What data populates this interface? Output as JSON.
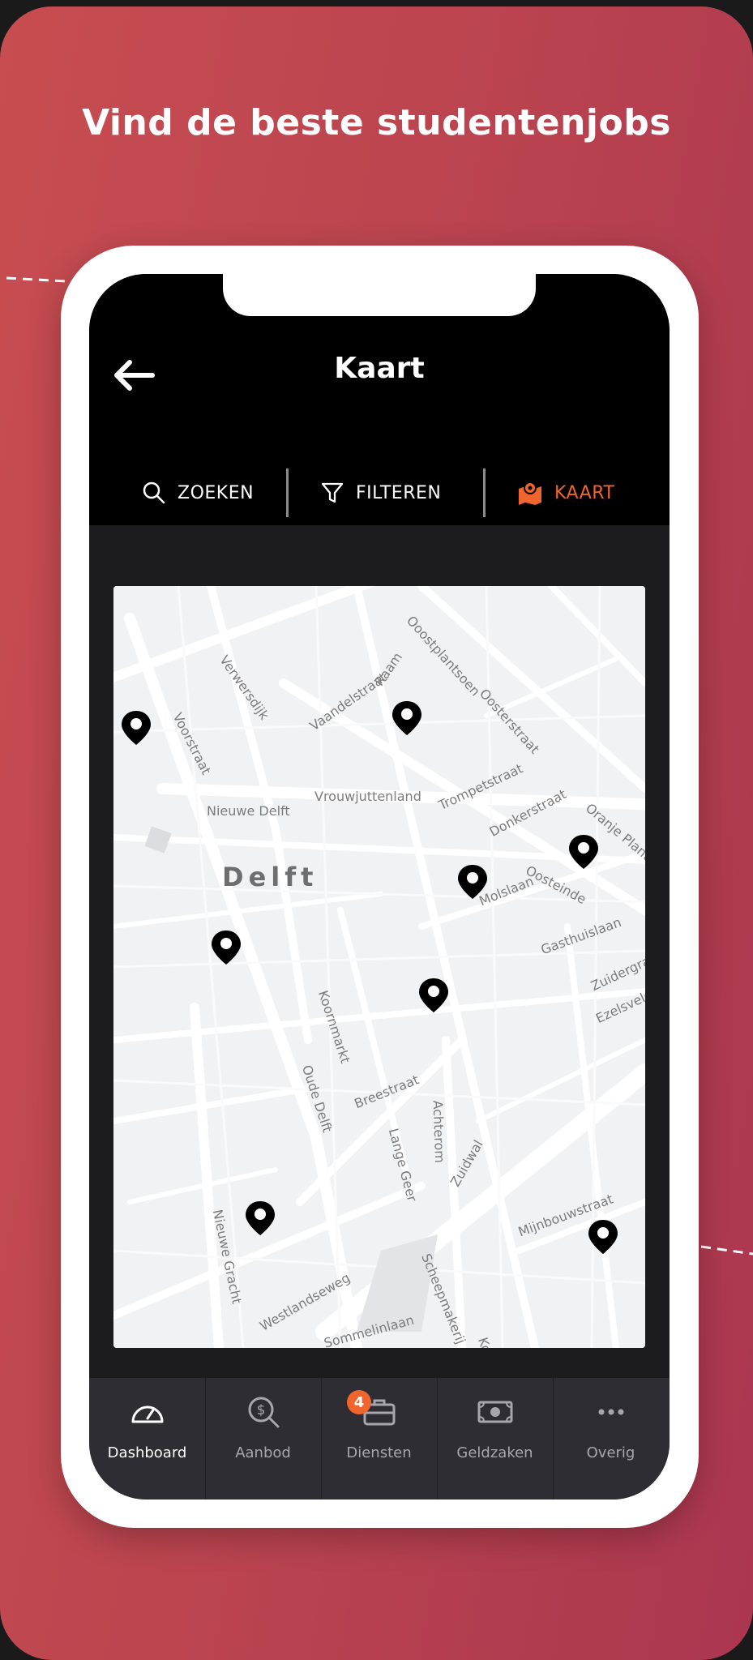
{
  "headline": "Vind de beste studentenjobs",
  "header": {
    "title": "Kaart",
    "toolbar": {
      "search": "ZOEKEN",
      "filter": "FILTEREN",
      "map": "KAART"
    }
  },
  "map": {
    "city": "Delft",
    "streets": [
      {
        "name": "Voorstraat"
      },
      {
        "name": "Verwersdijk"
      },
      {
        "name": "Vaandelstraat"
      },
      {
        "name": "Raam"
      },
      {
        "name": "Ooostplantsoen"
      },
      {
        "name": "Oosterstraat"
      },
      {
        "name": "Trompetstraat"
      },
      {
        "name": "Vrouwjuttenland"
      },
      {
        "name": "Nieuwe Delft"
      },
      {
        "name": "Donkerstraat"
      },
      {
        "name": "Oranje Plantage"
      },
      {
        "name": "Oosteinde"
      },
      {
        "name": "Molslaan"
      },
      {
        "name": "Gasthuislaan"
      },
      {
        "name": "Zuidergracht"
      },
      {
        "name": "Ezelsveldlaan"
      },
      {
        "name": "Koornmarkt"
      },
      {
        "name": "Oude Delft"
      },
      {
        "name": "Breestraat"
      },
      {
        "name": "Lange Geer"
      },
      {
        "name": "Achterom"
      },
      {
        "name": "Zuidwal"
      },
      {
        "name": "Mijnbouwstraat"
      },
      {
        "name": "Nieuwe Gracht"
      },
      {
        "name": "Westlandseweg"
      },
      {
        "name": "Scheepmakerij"
      },
      {
        "name": "Kolk"
      },
      {
        "name": "Sommelinlaan"
      }
    ]
  },
  "tabs": [
    {
      "label": "Dashboard",
      "icon": "dashboard-icon"
    },
    {
      "label": "Aanbod",
      "icon": "search-dollar-icon"
    },
    {
      "label": "Diensten",
      "icon": "briefcase-icon",
      "badge": "4"
    },
    {
      "label": "Geldzaken",
      "icon": "money-icon"
    },
    {
      "label": "Overig",
      "icon": "more-icon"
    }
  ],
  "colors": {
    "accent": "#f0642e",
    "background_gradient_start": "#c74d50",
    "background_gradient_end": "#ab3650"
  }
}
